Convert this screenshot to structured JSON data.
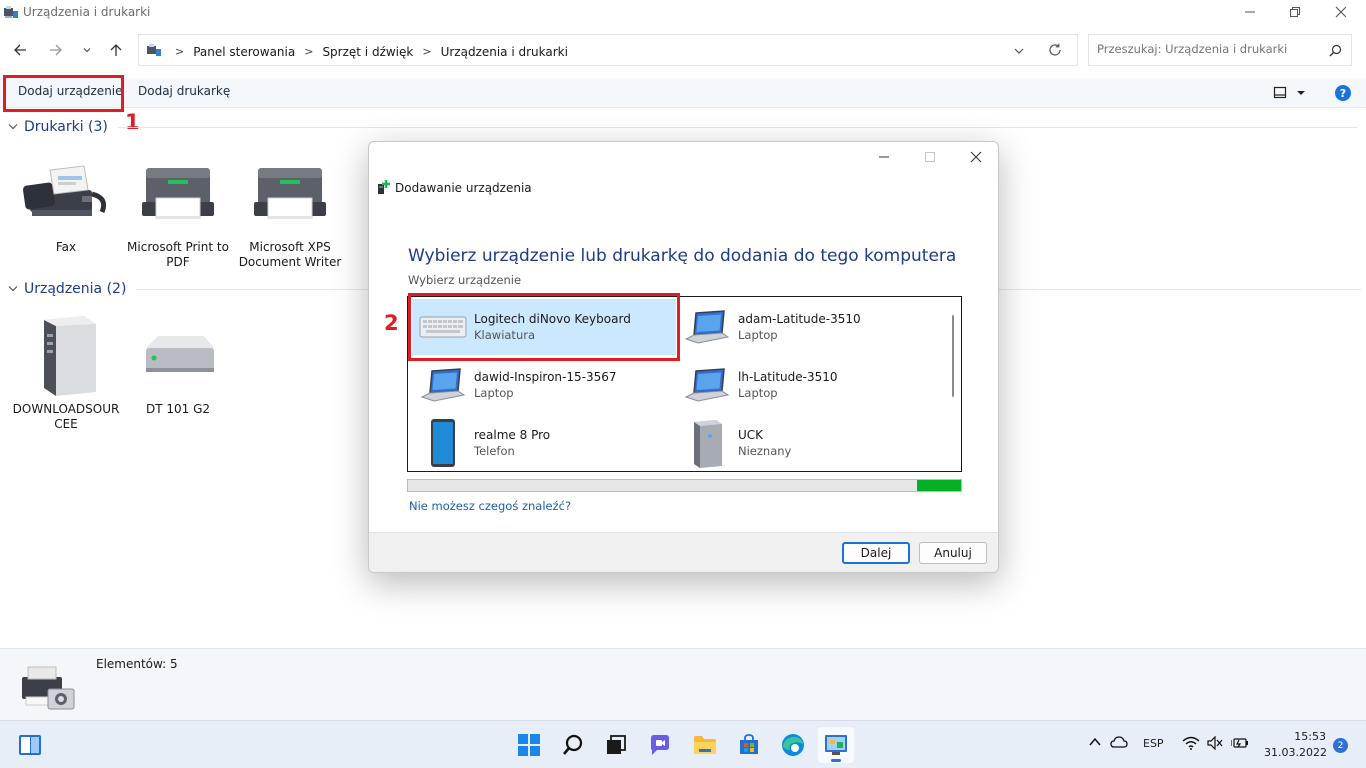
{
  "window": {
    "title": "Urządzenia i drukarki"
  },
  "address": {
    "crumbs": [
      "Panel sterowania",
      "Sprzęt i dźwięk",
      "Urządzenia i drukarki"
    ],
    "search_placeholder": "Przeszukaj: Urządzenia i drukarki"
  },
  "toolbar": {
    "add_device": "Dodaj urządzenie",
    "add_printer": "Dodaj drukarkę"
  },
  "annotations": {
    "one": "1",
    "two": "2"
  },
  "printers": {
    "header": "Drukarki (3)",
    "items": [
      {
        "label": "Fax",
        "icon": "fax-icon"
      },
      {
        "label": "Microsoft Print to PDF",
        "icon": "printer-icon"
      },
      {
        "label": "Microsoft XPS Document Writer",
        "icon": "printer-icon"
      }
    ]
  },
  "devices": {
    "header": "Urządzenia (2)",
    "items": [
      {
        "label": "DOWNLOADSOURCEE",
        "icon": "server-tower-icon"
      },
      {
        "label": "DT 101 G2",
        "icon": "external-drive-icon"
      }
    ]
  },
  "details": {
    "count": "Elementów: 5"
  },
  "dialog": {
    "title": "Dodawanie urządzenia",
    "heading": "Wybierz urządzenie lub drukarkę do dodania do tego komputera",
    "sublabel": "Wybierz urządzenie",
    "devices": [
      {
        "name": "Logitech diNovo Keyboard",
        "type": "Klawiatura",
        "icon": "keyboard-icon",
        "selected": true
      },
      {
        "name": "adam-Latitude-3510",
        "type": "Laptop",
        "icon": "laptop-icon"
      },
      {
        "name": "dawid-Inspiron-15-3567",
        "type": "Laptop",
        "icon": "laptop-icon"
      },
      {
        "name": "lh-Latitude-3510",
        "type": "Laptop",
        "icon": "laptop-icon"
      },
      {
        "name": "realme 8 Pro",
        "type": "Telefon",
        "icon": "phone-icon"
      },
      {
        "name": "UCK",
        "type": "Nieznany",
        "icon": "unknown-device-icon"
      }
    ],
    "progress_fraction": 0.92,
    "help_link": "Nie możesz czegoś znaleźć?",
    "next": "Dalej",
    "cancel": "Anuluj"
  },
  "taskbar": {
    "lang": "ESP",
    "time": "15:53",
    "date": "31.03.2022",
    "notifications": "2"
  },
  "colors": {
    "accent": "#1e3a8a",
    "highlight": "#e01c24",
    "selection": "#cce8ff",
    "progress": "#06b025"
  }
}
